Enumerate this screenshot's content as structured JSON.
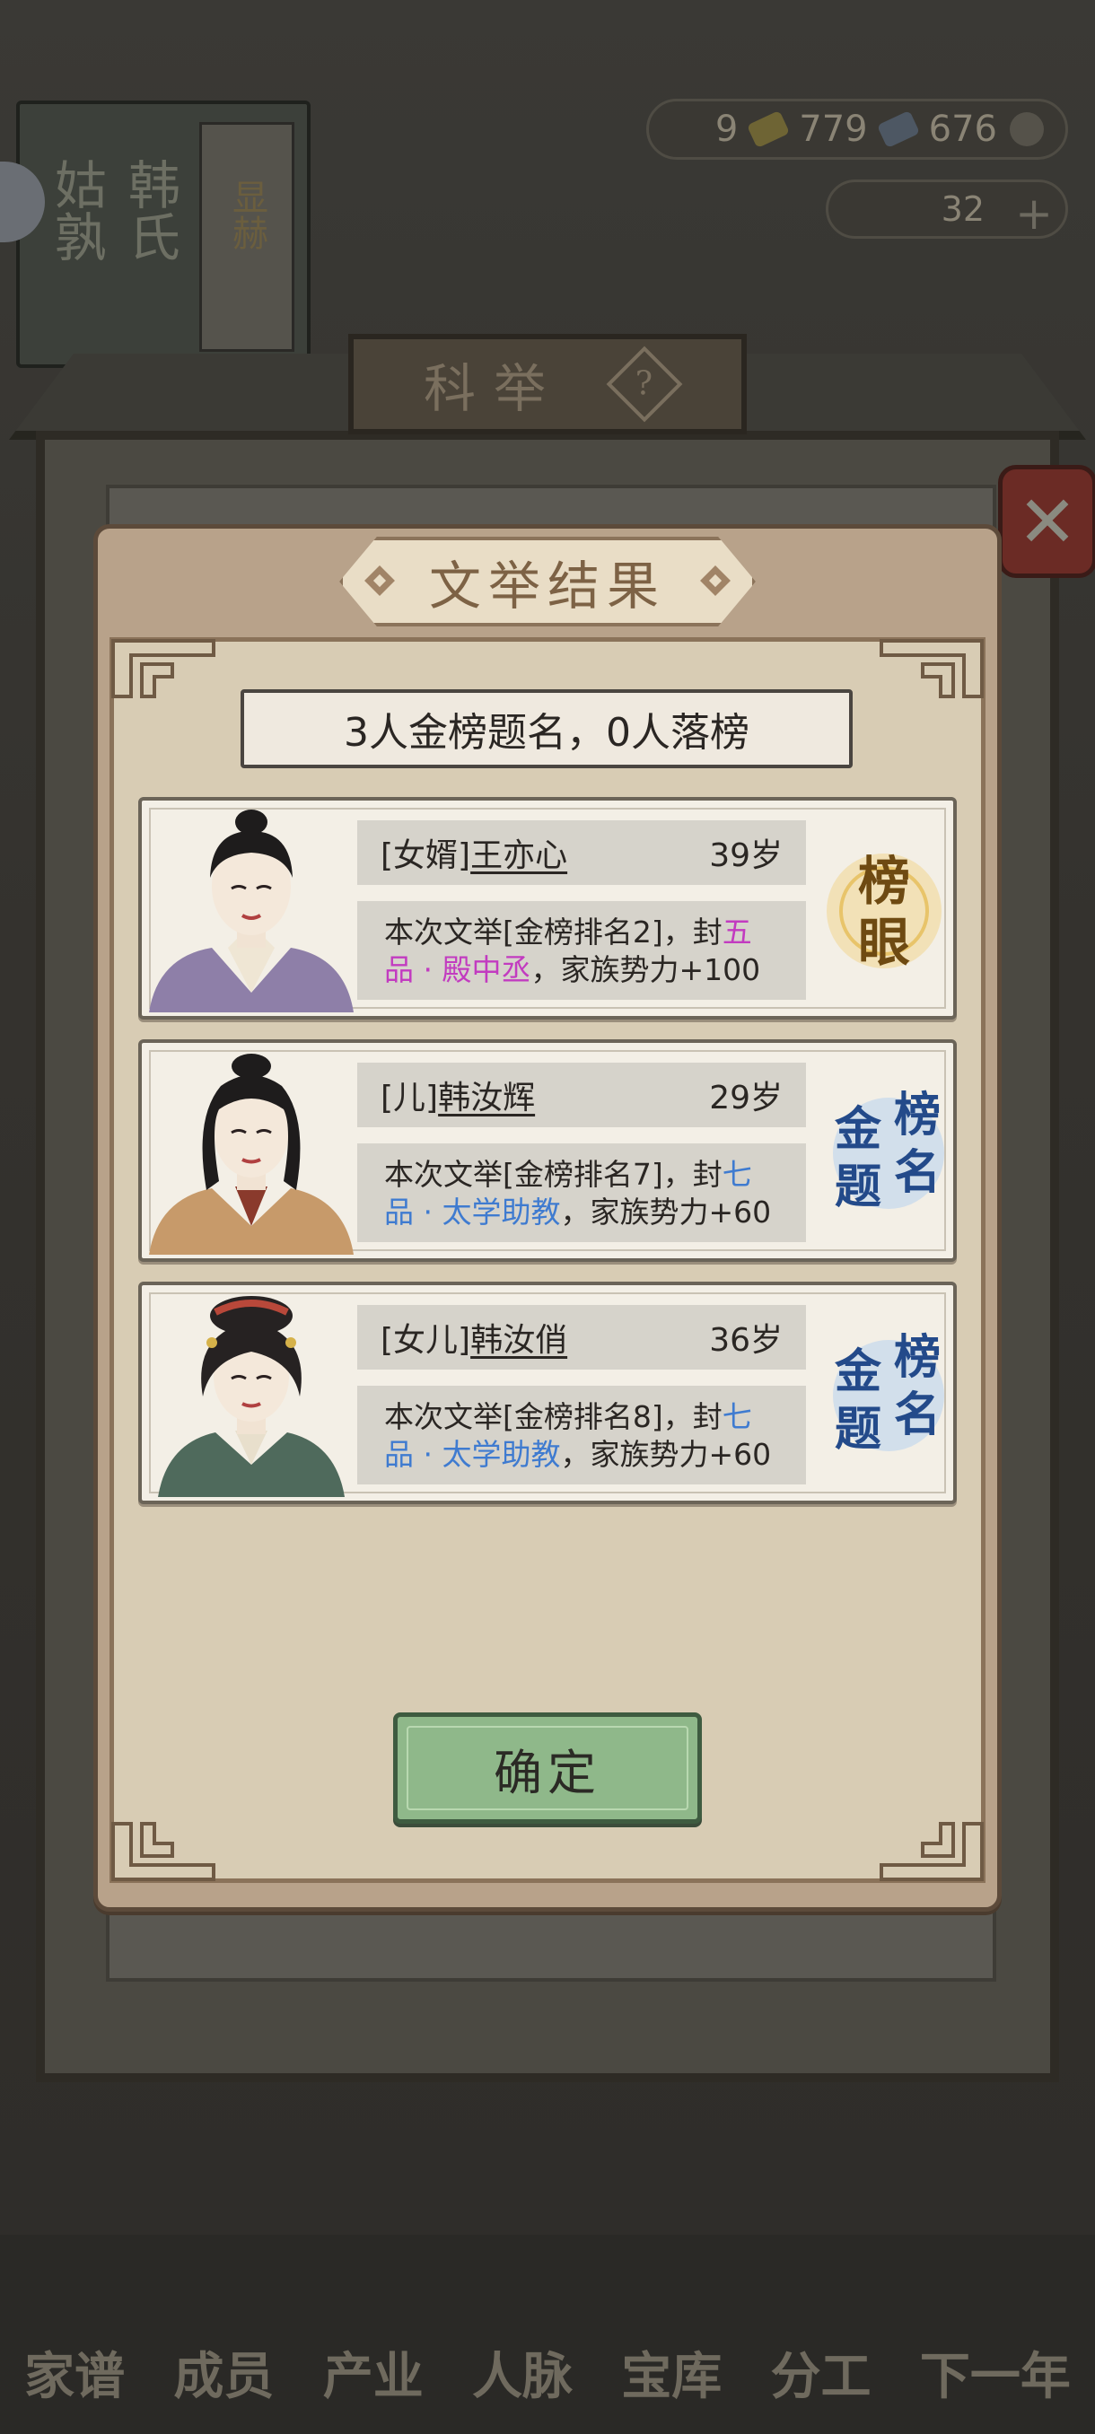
{
  "background": {
    "book_title": [
      "姑孰",
      "韩氏"
    ],
    "book_spine_label": "显赫",
    "currency": {
      "silver": "9",
      "tickets": "779",
      "coins": "676"
    },
    "gold": "32",
    "board_title": "科举",
    "help_label": "?",
    "nav": [
      "家谱",
      "成员",
      "产业",
      "人脉",
      "宝库",
      "分工",
      "下一年"
    ]
  },
  "dialog": {
    "title": "文举结果",
    "summary": "3人金榜题名，0人落榜",
    "confirm_label": "确定",
    "cards": [
      {
        "relation": "[女婿]",
        "name": "王亦心",
        "age": "39岁",
        "desc_prefix": "本次文举[金榜排名2]，封",
        "rank_title": "五品 · 殿中丞",
        "desc_suffix": "，家族势力+100",
        "rank_color": "#c23bc0",
        "badge": "榜眼",
        "badge_icon": "bangyan-badge-icon"
      },
      {
        "relation": "[儿]",
        "name": "韩汝辉",
        "age": "29岁",
        "desc_prefix": "本次文举[金榜排名7]，封",
        "rank_title": "七品 · 太学助教",
        "desc_suffix": "，家族势力+60",
        "rank_color": "#3f7bd0",
        "badge": "金榜题名",
        "badge_icon": "jinbang-badge-icon"
      },
      {
        "relation": "[女儿]",
        "name": "韩汝俏",
        "age": "36岁",
        "desc_prefix": "本次文举[金榜排名8]，封",
        "rank_title": "七品 · 太学助教",
        "desc_suffix": "，家族势力+60",
        "rank_color": "#3f7bd0",
        "badge": "金榜题名",
        "badge_icon": "jinbang-badge-icon"
      }
    ]
  }
}
